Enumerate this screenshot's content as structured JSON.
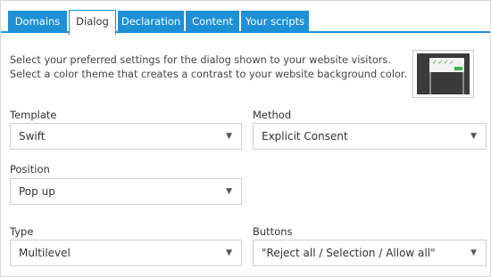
{
  "tabs": [
    {
      "label": "Domains",
      "active": false
    },
    {
      "label": "Dialog",
      "active": true
    },
    {
      "label": "Declaration",
      "active": false
    },
    {
      "label": "Content",
      "active": false
    },
    {
      "label": "Your scripts",
      "active": false
    }
  ],
  "intro": {
    "line1": "Select your preferred settings for the dialog shown to your website visitors.",
    "line2": "Select a color theme that creates a contrast to your website background color."
  },
  "preview": {
    "checks": "✓✓✓✓"
  },
  "fields": {
    "template": {
      "label": "Template",
      "value": "Swift"
    },
    "method": {
      "label": "Method",
      "value": "Explicit Consent"
    },
    "position": {
      "label": "Position",
      "value": "Pop up"
    },
    "type": {
      "label": "Type",
      "value": "Multilevel"
    },
    "buttons": {
      "label": "Buttons",
      "value": "\"Reject all / Selection / Allow all\""
    }
  },
  "icons": {
    "caret": "▼"
  },
  "colors": {
    "accent": "#1e90d6",
    "preview_ok": "#39b54a"
  }
}
